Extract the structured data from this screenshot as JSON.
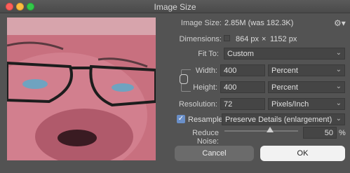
{
  "window": {
    "title": "Image Size"
  },
  "image_size": {
    "label": "Image Size:",
    "value": "2.85M (was 182.3K)"
  },
  "dimensions": {
    "label": "Dimensions:",
    "width": "864 px",
    "times": "×",
    "height": "1152 px"
  },
  "fit_to": {
    "label": "Fit To:",
    "value": "Custom"
  },
  "width": {
    "label": "Width:",
    "value": "400",
    "unit": "Percent"
  },
  "height": {
    "label": "Height:",
    "value": "400",
    "unit": "Percent"
  },
  "resolution": {
    "label": "Resolution:",
    "value": "72",
    "unit": "Pixels/Inch"
  },
  "resample": {
    "label": "Resample:",
    "checked": true,
    "method": "Preserve Details (enlargement)"
  },
  "reduce_noise": {
    "label": "Reduce Noise:",
    "value": "50",
    "unit": "%",
    "slider_fraction": 0.5
  },
  "buttons": {
    "cancel": "Cancel",
    "ok": "OK"
  },
  "icons": {
    "gear": "gear-icon",
    "chain": "link-chain-icon",
    "chevron": "chevron-down-icon"
  }
}
